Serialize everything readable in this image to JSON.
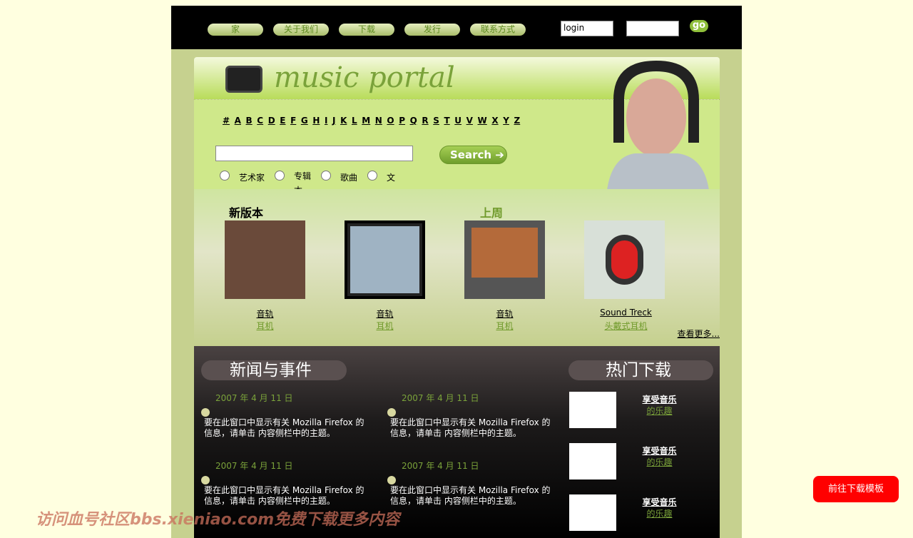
{
  "nav": [
    "家",
    "关于我们",
    "下载",
    "发行",
    "联系方式"
  ],
  "login": {
    "user_value": "login",
    "password_value": "",
    "go_label": "go"
  },
  "banner": {
    "logo": "music portal",
    "alphabet": [
      "#",
      "A",
      "B",
      "C",
      "D",
      "E",
      "F",
      "G",
      "H",
      "I",
      "J",
      "K",
      "L",
      "M",
      "N",
      "O",
      "P",
      "Q",
      "R",
      "S",
      "T",
      "U",
      "V",
      "W",
      "X",
      "Y",
      "Z"
    ],
    "search_value": "",
    "search_label": "Search",
    "radios": [
      "艺术家",
      "专辑本",
      "歌曲",
      "文"
    ]
  },
  "releases": {
    "new_title": "新版本",
    "week_title": "上周",
    "items": [
      {
        "title": "音轨",
        "sub": "耳机"
      },
      {
        "title": "音轨",
        "sub": "耳机"
      },
      {
        "title": "音轨",
        "sub": "耳机"
      },
      {
        "title": "Sound Treck",
        "sub": "头戴式耳机"
      }
    ],
    "more": "查看更多..."
  },
  "news": {
    "title": "新闻与事件",
    "items": [
      {
        "date": "2007 年 4 月 11 日",
        "text": "要在此窗口中显示有关 Mozilla Firefox 的信息，请单击 内容侧栏中的主题。"
      },
      {
        "date": "2007 年 4 月 11 日",
        "text": "要在此窗口中显示有关 Mozilla Firefox 的信息，请单击 内容侧栏中的主题。"
      },
      {
        "date": "2007 年 4 月 11 日",
        "text": "要在此窗口中显示有关 Mozilla Firefox 的信息，请单击 内容侧栏中的主题。"
      },
      {
        "date": "2007 年 4 月 11 日",
        "text": "要在此窗口中显示有关 Mozilla Firefox 的信息，请单击 内容侧栏中的主题。"
      }
    ]
  },
  "downloads": {
    "title": "热门下载",
    "items": [
      {
        "t1": "享受音乐",
        "t2": "的乐趣"
      },
      {
        "t1": "享受音乐",
        "t2": "的乐趣"
      },
      {
        "t1": "享受音乐",
        "t2": "的乐趣"
      }
    ]
  },
  "watermark": "访问血号社区bbs.xieniao.com免费下载更多内容",
  "download_template": "前往下载模板"
}
